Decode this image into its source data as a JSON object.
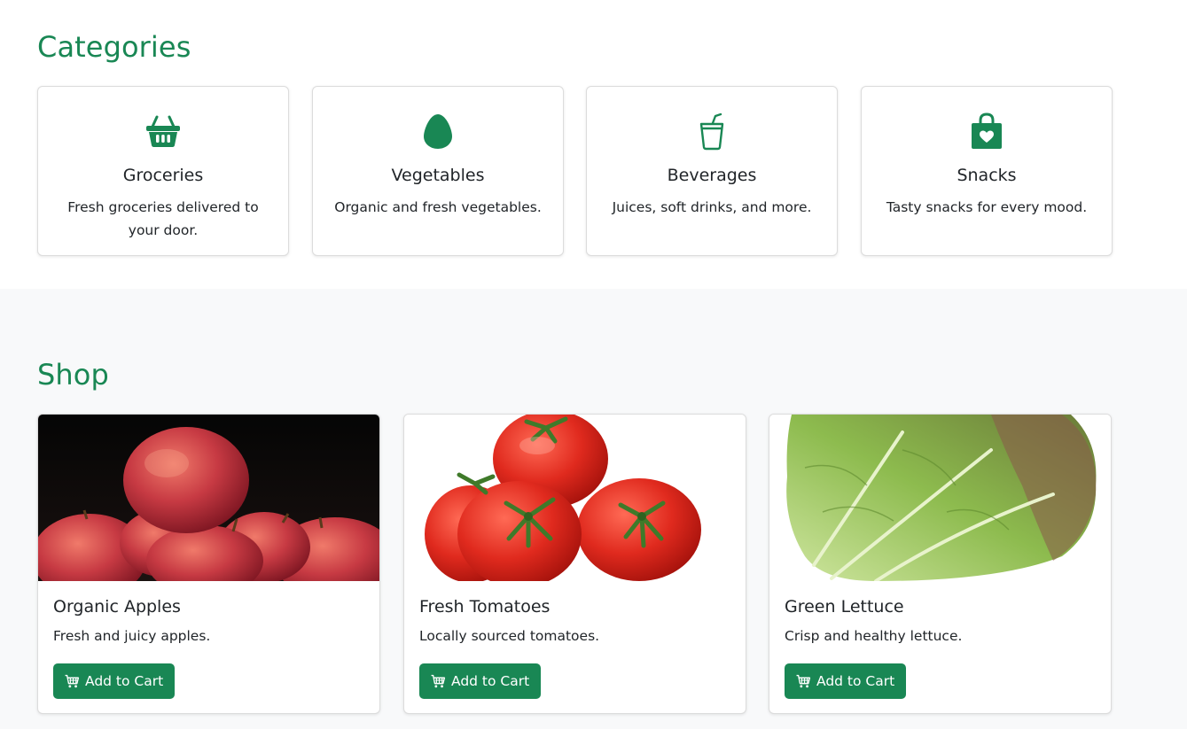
{
  "colors": {
    "accent": "#198754",
    "text": "#212529",
    "shop_bg": "#f8f9fa"
  },
  "categories": {
    "title": "Categories",
    "items": [
      {
        "name": "Groceries",
        "description": "Fresh groceries delivered to your door.",
        "icon": "basket-icon"
      },
      {
        "name": "Vegetables",
        "description": "Organic and fresh vegetables.",
        "icon": "egg-icon"
      },
      {
        "name": "Beverages",
        "description": "Juices, soft drinks, and more.",
        "icon": "cup-straw-icon"
      },
      {
        "name": "Snacks",
        "description": "Tasty snacks for every mood.",
        "icon": "bag-heart-icon"
      }
    ]
  },
  "shop": {
    "title": "Shop",
    "products": [
      {
        "name": "Organic Apples",
        "description": "Fresh and juicy apples.",
        "button_label": "Add to Cart",
        "button_icon": "cart-icon"
      },
      {
        "name": "Fresh Tomatoes",
        "description": "Locally sourced tomatoes.",
        "button_label": "Add to Cart",
        "button_icon": "cart-icon"
      },
      {
        "name": "Green Lettuce",
        "description": "Crisp and healthy lettuce.",
        "button_label": "Add to Cart",
        "button_icon": "cart-icon"
      }
    ]
  }
}
